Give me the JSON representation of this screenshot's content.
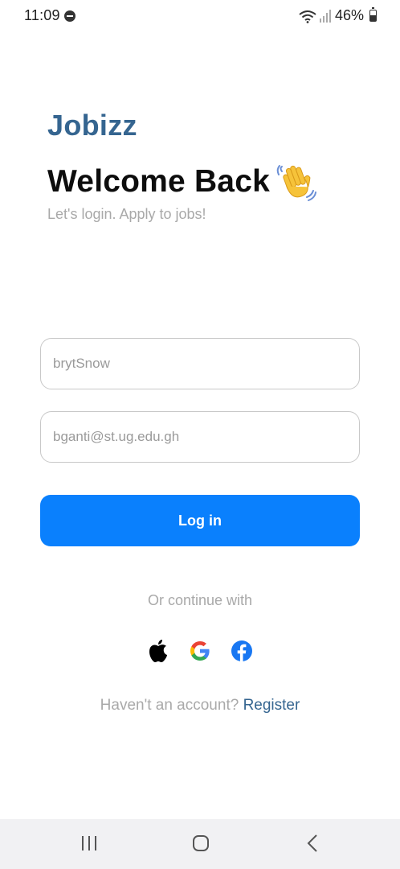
{
  "status_bar": {
    "time": "11:09",
    "battery": "46%",
    "icons": [
      "do-not-disturb-icon",
      "wifi-icon",
      "signal-icon",
      "battery-icon"
    ]
  },
  "header": {
    "brand": "Jobizz",
    "title": "Welcome Back",
    "title_emoji_icon": "waving-hand-icon",
    "subtitle": "Let's login. Apply to jobs!"
  },
  "form": {
    "username_value": "brytSnow",
    "email_value": "bganti@st.ug.edu.gh",
    "login_label": "Log in"
  },
  "social": {
    "divider_text": "Or continue with",
    "providers": [
      "apple-icon",
      "google-icon",
      "facebook-icon"
    ]
  },
  "footer": {
    "prompt": "Haven't an account?",
    "register_label": "Register"
  },
  "nav_bar": {
    "buttons": [
      "recent-apps-icon",
      "home-icon",
      "back-icon"
    ]
  },
  "colors": {
    "brand": "#356590",
    "primary_button": "#0a80fd",
    "muted_text": "#a9a9a9",
    "facebook": "#1877f2"
  }
}
